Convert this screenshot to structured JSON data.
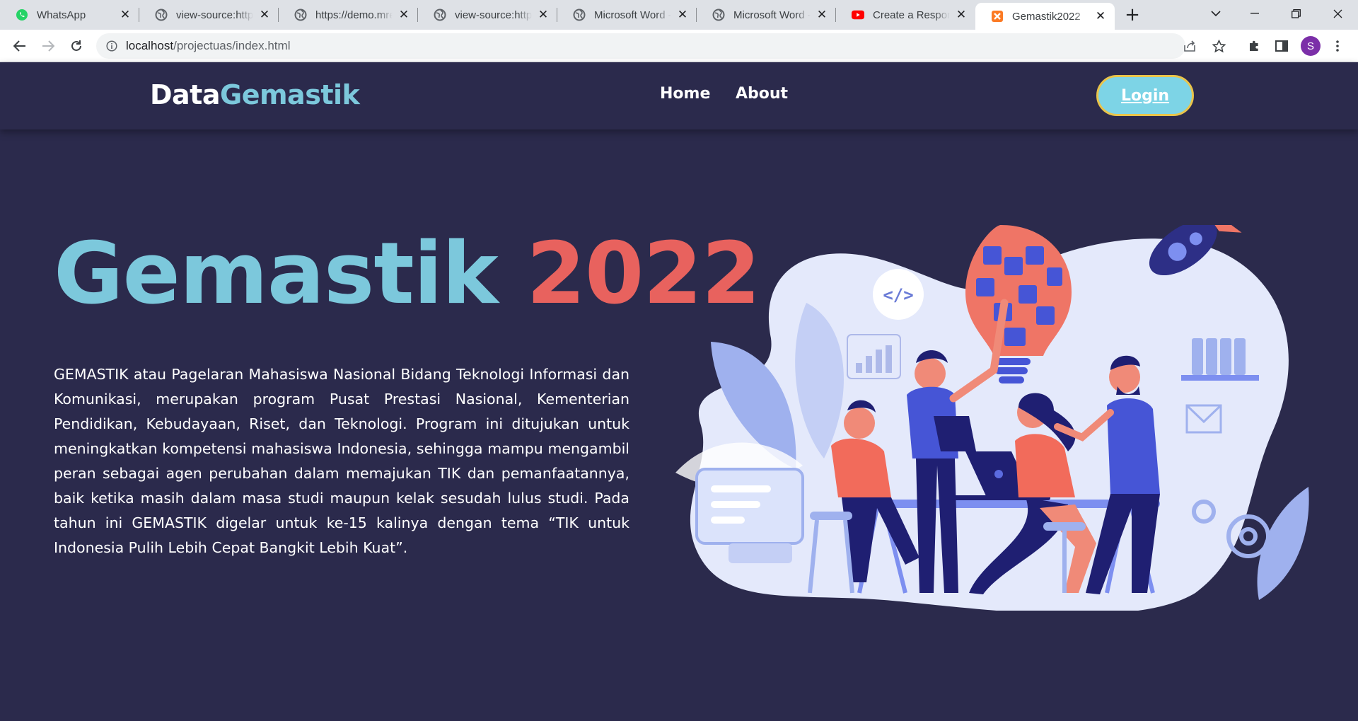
{
  "browser": {
    "tabs": [
      {
        "title": "WhatsApp",
        "icon": "whatsapp-icon",
        "active": false
      },
      {
        "title": "view-source:https",
        "icon": "globe-icon",
        "active": false
      },
      {
        "title": "https://demo.mre",
        "icon": "globe-icon",
        "active": false
      },
      {
        "title": "view-source:https",
        "icon": "globe-icon",
        "active": false
      },
      {
        "title": "Microsoft Word -",
        "icon": "globe-icon",
        "active": false
      },
      {
        "title": "Microsoft Word -",
        "icon": "globe-icon",
        "active": false
      },
      {
        "title": "Create a Respons",
        "icon": "youtube-icon",
        "active": false
      },
      {
        "title": "Gemastik2022",
        "icon": "xampp-icon",
        "active": true
      }
    ],
    "url_host": "localhost",
    "url_path": "/projectuas/index.html",
    "profile_initial": "S"
  },
  "nav": {
    "logo_part1": "Data",
    "logo_part2": "Gemastik",
    "links": [
      "Home",
      "About"
    ],
    "login_label": "Login"
  },
  "hero": {
    "title_word1": "Gemastik",
    "title_word2": "2022",
    "description": "GEMASTIK atau Pagelaran Mahasiswa Nasional Bidang Teknologi Informasi dan Komunikasi, merupakan program Pusat Prestasi Nasional, Kementerian Pendidikan, Kebudayaan, Riset, dan Teknologi. Program ini ditujukan untuk meningkatkan kompetensi mahasiswa Indonesia, sehingga mampu mengambil peran sebagai agen perubahan dalam memajukan TIK dan pemanfaatannya, baik ketika masih dalam masa studi maupun kelak sesudah lulus studi. Pada tahun ini GEMASTIK digelar untuk ke-15 kalinya dengan tema “TIK untuk Indonesia Pulih Lebih Cepat Bangkit Lebih Kuat”.",
    "code_badge": "</>"
  },
  "colors": {
    "page_bg": "#2b2a4c",
    "accent_blue": "#7cc8dc",
    "accent_red": "#e8625e",
    "login_bg": "#7dd4e6",
    "login_border": "#e9c44a"
  }
}
